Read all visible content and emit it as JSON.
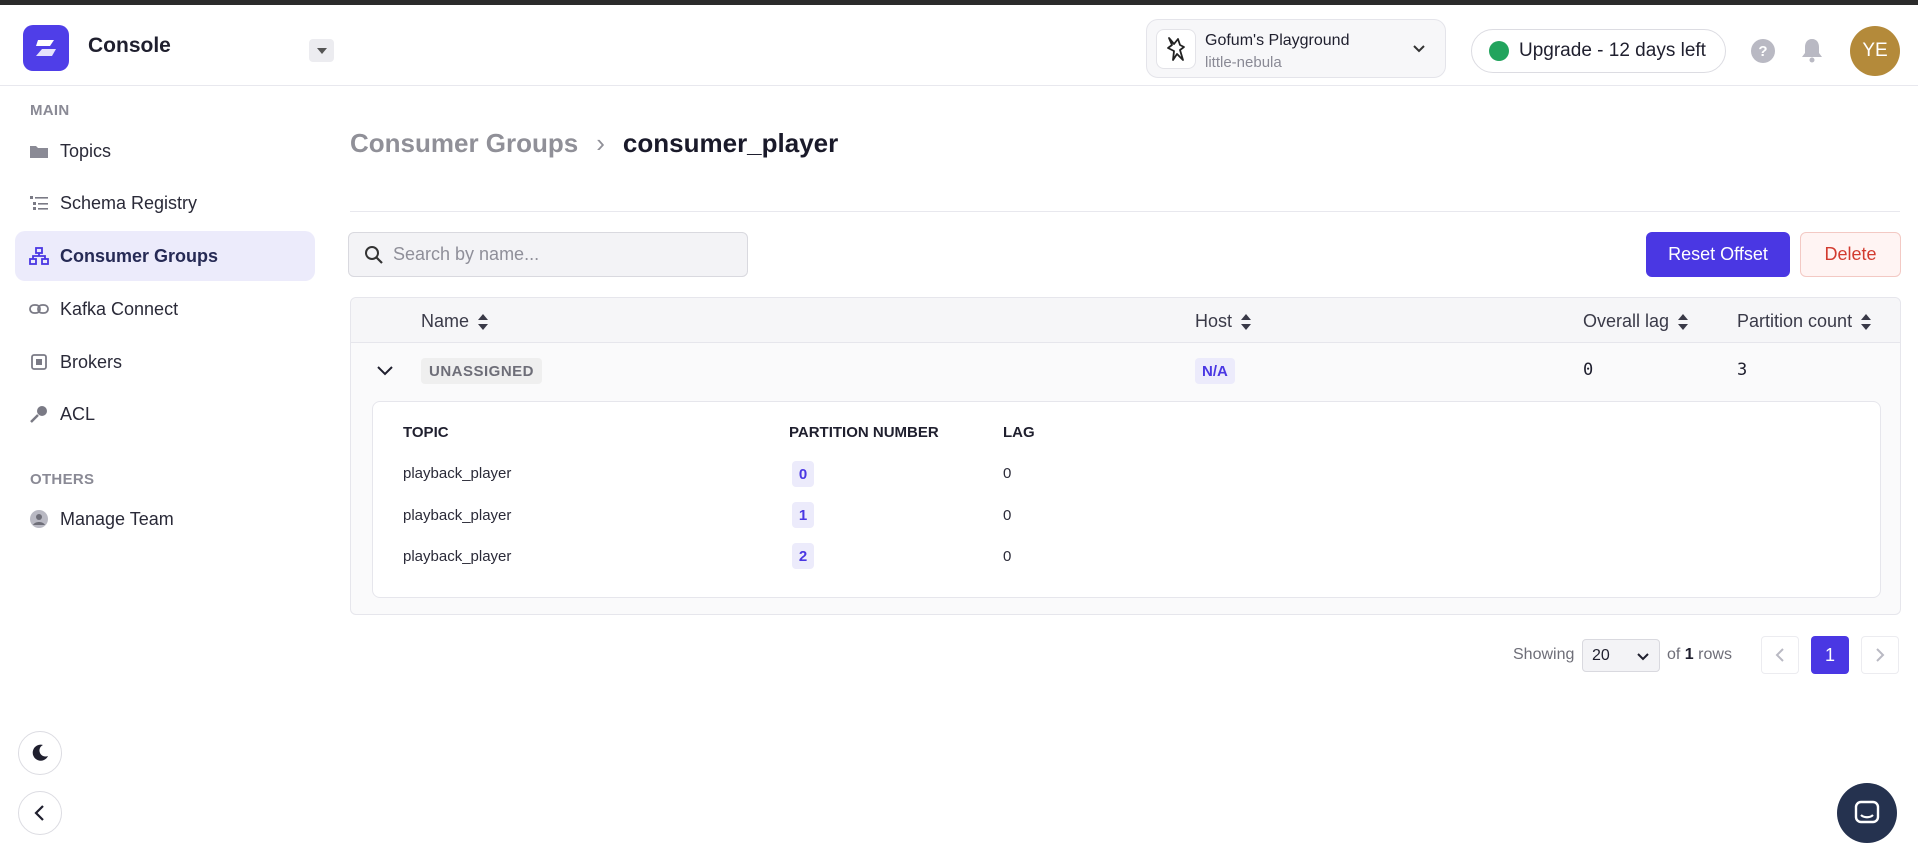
{
  "app": {
    "title": "Console",
    "workspace": {
      "name": "Gofum's Playground",
      "cluster": "little-nebula"
    },
    "upgrade_label": "Upgrade - 12 days left",
    "help_label": "?",
    "user_initials": "YE"
  },
  "sidebar": {
    "main_label": "MAIN",
    "items": [
      {
        "label": "Topics",
        "icon": "folder-icon"
      },
      {
        "label": "Schema Registry",
        "icon": "list-icon"
      },
      {
        "label": "Consumer Groups",
        "icon": "hierarchy-icon",
        "active": true
      },
      {
        "label": "Kafka Connect",
        "icon": "link-icon"
      },
      {
        "label": "Brokers",
        "icon": "chip-icon"
      },
      {
        "label": "ACL",
        "icon": "key-icon"
      }
    ],
    "others_label": "OTHERS",
    "others_items": [
      {
        "label": "Manage Team",
        "icon": "user-circle-icon"
      }
    ]
  },
  "breadcrumb": {
    "parent": "Consumer Groups",
    "separator": "›",
    "current": "consumer_player"
  },
  "search": {
    "placeholder": "Search by name..."
  },
  "actions": {
    "reset_offset": "Reset Offset",
    "delete": "Delete"
  },
  "table": {
    "columns": [
      "Name",
      "Host",
      "Overall lag",
      "Partition count"
    ],
    "rows": [
      {
        "name": "UNASSIGNED",
        "host": "N/A",
        "overall_lag": "0",
        "partition_count": "3"
      }
    ],
    "detail": {
      "columns": [
        "TOPIC",
        "PARTITION NUMBER",
        "LAG"
      ],
      "rows": [
        {
          "topic": "playback_player",
          "partition": "0",
          "lag": "0"
        },
        {
          "topic": "playback_player",
          "partition": "1",
          "lag": "0"
        },
        {
          "topic": "playback_player",
          "partition": "2",
          "lag": "0"
        }
      ]
    }
  },
  "pagination": {
    "showing_label": "Showing",
    "page_size": "20",
    "of_label": "of",
    "total": "1",
    "rows_label": "rows",
    "current_page": "1"
  },
  "colors": {
    "accent": "#4a37e3",
    "danger": "#d23b2f",
    "status_ok": "#22a45d"
  }
}
